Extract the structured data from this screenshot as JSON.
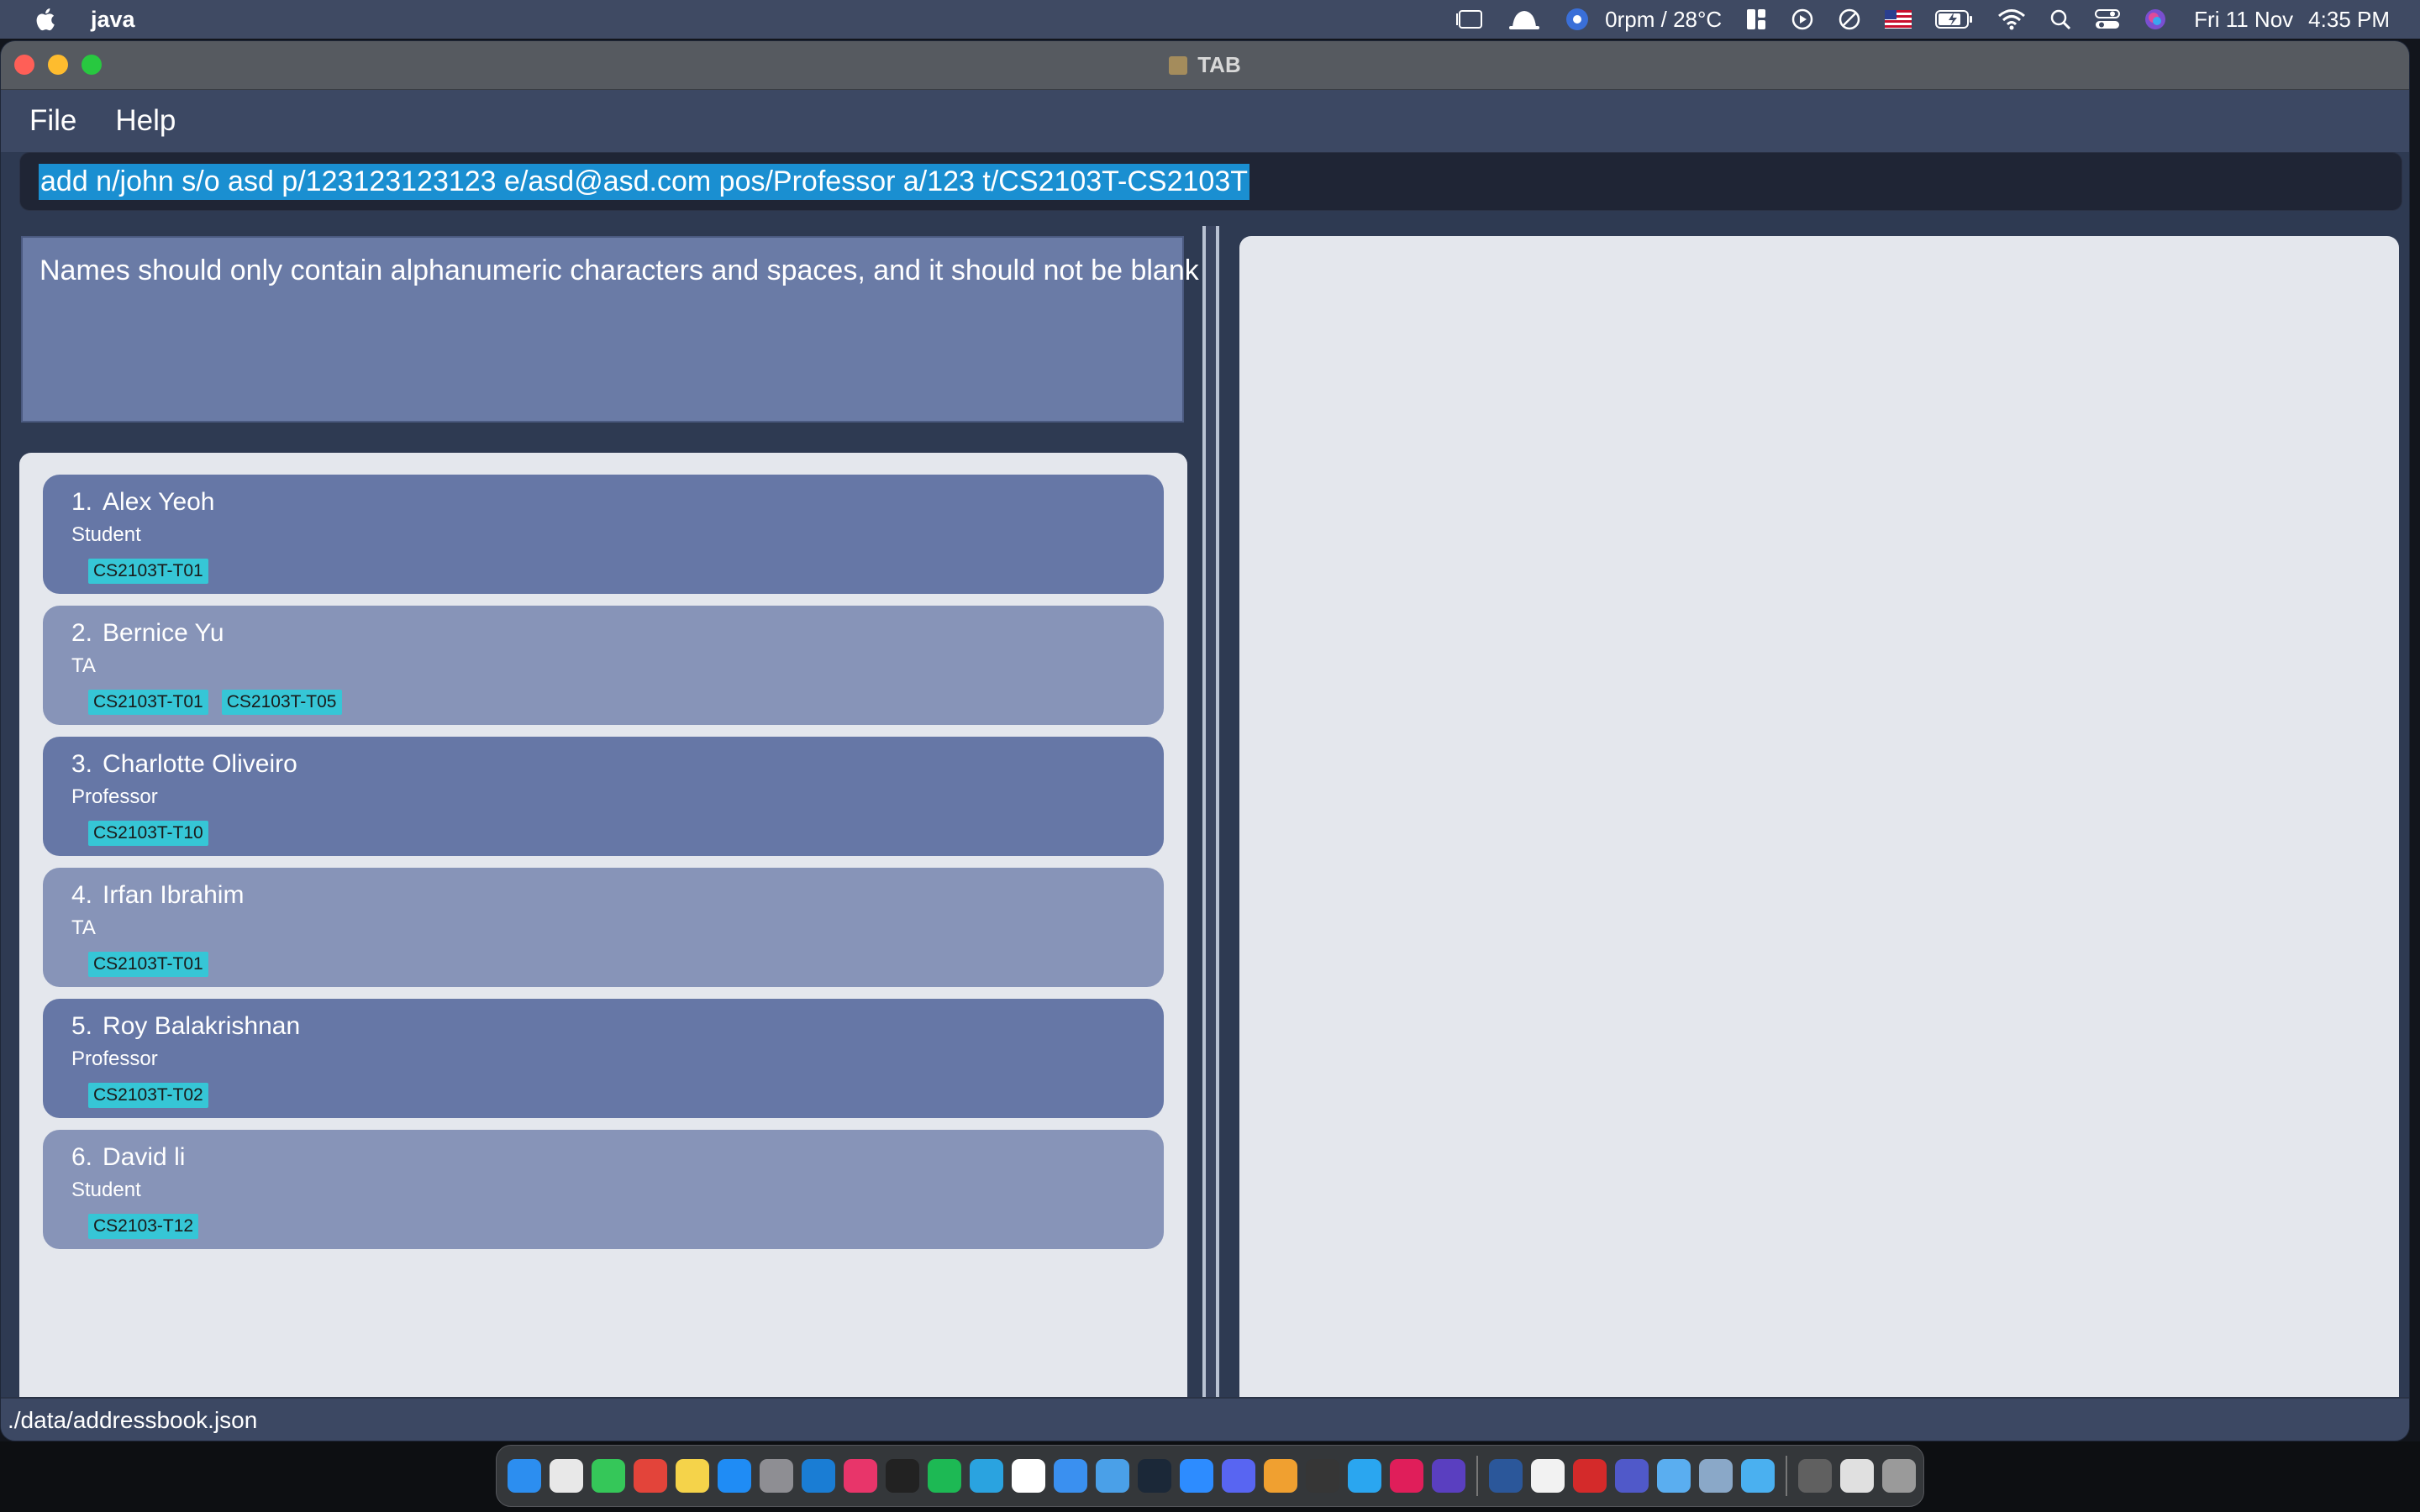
{
  "menubar": {
    "app_name": "java",
    "fan_temp": "0rpm / 28°C",
    "date": "Fri 11 Nov",
    "time": "4:35 PM"
  },
  "window": {
    "title": "TAB"
  },
  "menu": {
    "file": "File",
    "help": "Help"
  },
  "command": {
    "text": "add n/john s/o asd p/123123123123 e/asd@asd.com pos/Professor a/123 t/CS2103T-CS2103T"
  },
  "result": {
    "message": "Names should only contain alphanumeric characters and spaces, and it should not be blank"
  },
  "persons": [
    {
      "index": "1.",
      "name": "Alex Yeoh",
      "position": "Student",
      "tags": [
        "CS2103T-T01"
      ]
    },
    {
      "index": "2.",
      "name": "Bernice Yu",
      "position": "TA",
      "tags": [
        "CS2103T-T01",
        "CS2103T-T05"
      ]
    },
    {
      "index": "3.",
      "name": "Charlotte Oliveiro",
      "position": "Professor",
      "tags": [
        "CS2103T-T10"
      ]
    },
    {
      "index": "4.",
      "name": "Irfan Ibrahim",
      "position": "TA",
      "tags": [
        "CS2103T-T01"
      ]
    },
    {
      "index": "5.",
      "name": "Roy Balakrishnan",
      "position": "Professor",
      "tags": [
        "CS2103T-T02"
      ]
    },
    {
      "index": "6.",
      "name": "David li",
      "position": "Student",
      "tags": [
        "CS2103-T12"
      ]
    }
  ],
  "status": {
    "path": "./data/addressbook.json"
  },
  "colors": {
    "card_odd": "#6677a6",
    "card_even": "#8794b8",
    "tag": "#36c6d6",
    "selection": "#1a8fd1"
  },
  "dock_icons": [
    "finder-icon",
    "launchpad-icon",
    "facetime-icon",
    "chrome-icon",
    "notes-icon",
    "app-store-icon",
    "system-settings-icon",
    "vscode-icon",
    "intellij-icon",
    "terminal-icon",
    "spotify-icon",
    "telegram-icon",
    "notion-icon",
    "mail-icon",
    "preview-icon",
    "steam-icon",
    "zoom-icon",
    "discord-icon",
    "garageband-icon",
    "obs-icon",
    "maps-icon",
    "slack-icon",
    "app-icon",
    "word-icon",
    "textedit-icon",
    "acrobat-icon",
    "teams-icon",
    "folder-icon",
    "screenshot-icon",
    "downloads-icon",
    "messages-icon",
    "display-icon",
    "trash-icon"
  ]
}
